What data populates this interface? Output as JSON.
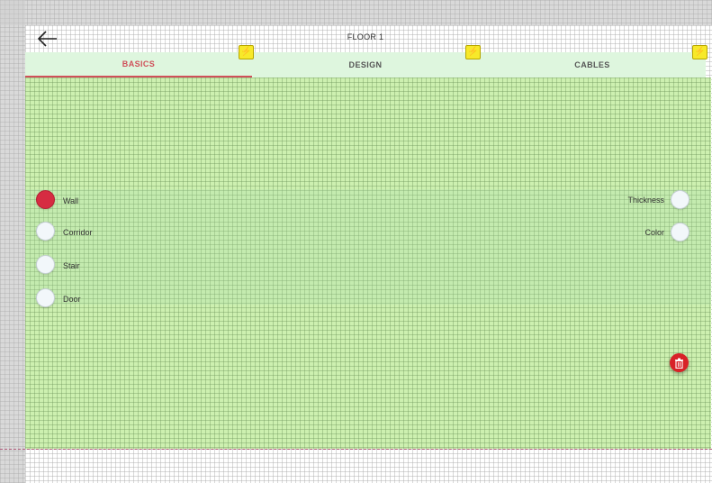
{
  "header": {
    "title": "FLOOR 1",
    "back_icon": "arrow-left-icon"
  },
  "tabs": [
    {
      "label": "BASICS",
      "active": true,
      "badge_icon": "lightning-bolt-icon"
    },
    {
      "label": "DESIGN",
      "active": false,
      "badge_icon": "lightning-bolt-icon"
    },
    {
      "label": "CABLES",
      "active": false,
      "badge_icon": "lightning-bolt-icon"
    }
  ],
  "tools": [
    {
      "label": "Wall",
      "selected": true
    },
    {
      "label": "Corridor",
      "selected": false
    },
    {
      "label": "Stair",
      "selected": false
    },
    {
      "label": "Door",
      "selected": false
    }
  ],
  "properties": [
    {
      "label": "Thickness"
    },
    {
      "label": "Color"
    }
  ],
  "delete_button": {
    "icon": "trash-icon"
  },
  "colors": {
    "accent": "#d0505a",
    "selected_radio": "#d62c42",
    "tab_bar": "#def6de",
    "work_area": "#cdf0b0",
    "badge": "#f7e92a",
    "delete": "#d82228"
  }
}
